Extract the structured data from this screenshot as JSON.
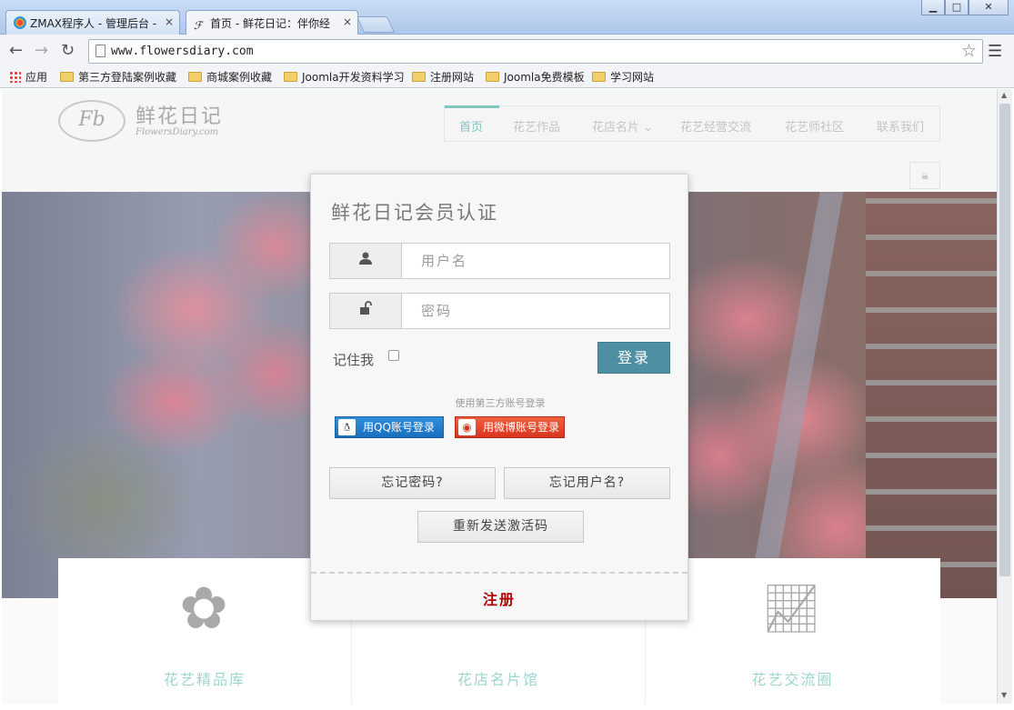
{
  "browser": {
    "tabs": [
      {
        "title": "ZMAX程序人 - 管理后台 -",
        "icon": "joomla-icon"
      },
      {
        "title": "首页 - 鲜花日记：伴你经",
        "icon": "fd-logo-icon"
      }
    ],
    "close_glyph": "×",
    "window_controls": [
      "▁",
      "□",
      "✕"
    ],
    "url": "www.flowersdiary.com",
    "bookmarks": [
      "应用",
      "第三方登陆案例收藏",
      "商城案例收藏",
      "Joomla开发资料学习",
      "注册网站",
      "Joomla免费模板",
      "学习网站"
    ]
  },
  "site": {
    "logo_mark": "Fb",
    "logo_text": "鲜花日记",
    "logo_sub": "FlowersDiary.com",
    "nav": [
      "首页",
      "花艺作品",
      "花店名片 ⌄",
      "花艺经营交流",
      "花艺师社区",
      "联系我们"
    ],
    "accent": "#7fc6bf",
    "features": [
      "花艺精品库",
      "花店名片馆",
      "花艺交流圈"
    ]
  },
  "login": {
    "title": "鲜花日记会员认证",
    "username_placeholder": "用户名",
    "password_placeholder": "密码",
    "remember_label": "记住我",
    "login_button": "登录",
    "third_party_label": "使用第三方账号登录",
    "qq_button": "用QQ账号登录",
    "weibo_button": "用微博账号登录",
    "forgot_password": "忘记密码?",
    "forgot_username": "忘记用户名?",
    "resend_activation": "重新发送激活码",
    "register": "注册",
    "login_button_color": "#4e8fa4",
    "register_color": "#b00000"
  }
}
